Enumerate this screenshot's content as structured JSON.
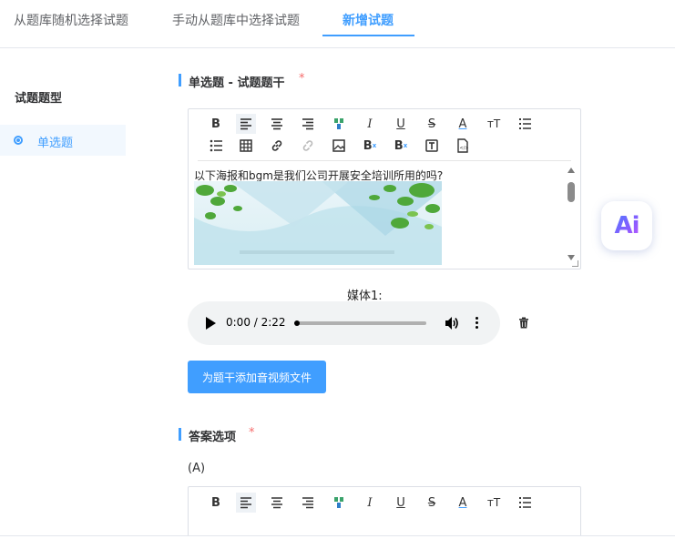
{
  "tabs": [
    {
      "label": "从题库随机选择试题"
    },
    {
      "label": "手动从题库中选择试题"
    },
    {
      "label": "新增试题",
      "active": true
    }
  ],
  "sidebar": {
    "title": "试题题型",
    "items": [
      {
        "label": "单选题",
        "selected": true
      }
    ]
  },
  "stem": {
    "header": "单选题 - 试题题干",
    "required_mark": "*",
    "content_text": "以下海报和bgm是我们公司开展安全培训所用的吗?"
  },
  "toolbar_icons": [
    "bold-icon",
    "align-left-icon",
    "align-center-icon",
    "align-right-icon",
    "format-brush-icon",
    "italic-icon",
    "underline-icon",
    "strikethrough-icon",
    "font-color-icon",
    "font-size-icon",
    "ordered-list-icon",
    "unordered-list-icon",
    "table-icon",
    "link-icon",
    "unlink-icon",
    "image-icon",
    "superscript-icon",
    "subscript-icon",
    "text-box-icon",
    "source-code-icon"
  ],
  "media": {
    "label": "媒体1:",
    "time": "0:00 / 2:22",
    "progress": 0.0
  },
  "upload_button": "为题干添加音视频文件",
  "answers": {
    "header": "答案选项",
    "required_mark": "*",
    "first_option_label": "(A)"
  },
  "ai_button_text": "Ai",
  "colors": {
    "accent": "#409eff",
    "required": "#f56c6c"
  }
}
